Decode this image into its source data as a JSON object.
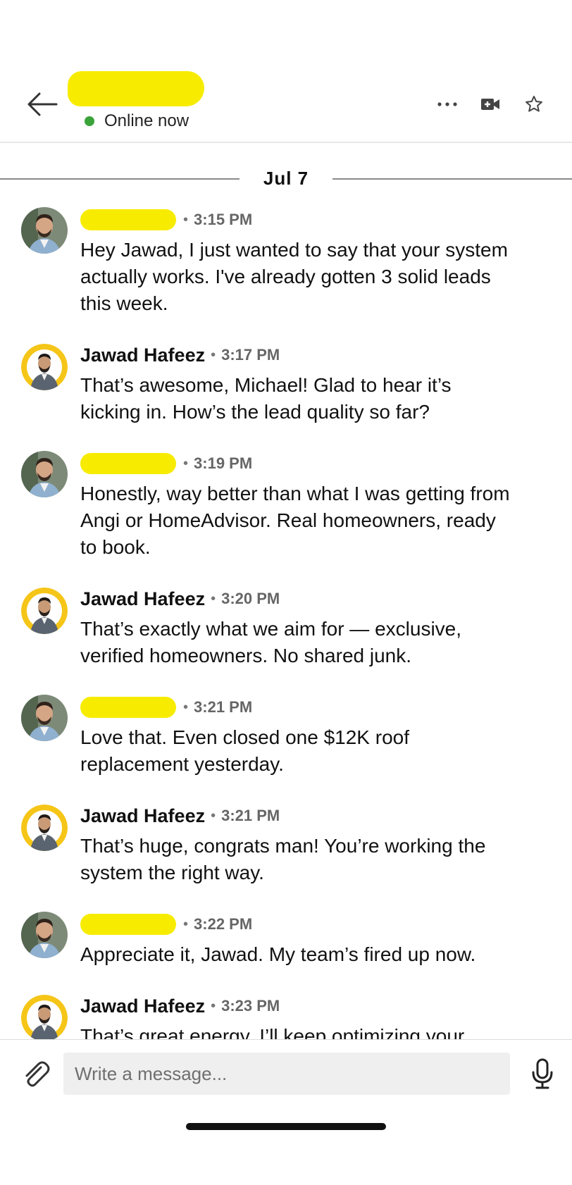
{
  "header": {
    "status": "Online now",
    "status_color": "#3aa33a"
  },
  "date_divider": "Jul 7",
  "messages": [
    {
      "sender": "",
      "time": "3:15 PM",
      "text": "Hey Jawad, I just wanted to say that your system actually works. I've already gotten 3 solid leads this week.",
      "from_self": false
    },
    {
      "sender": "Jawad Hafeez",
      "time": "3:17 PM",
      "text": "That’s awesome, Michael! Glad to hear it’s kicking in. How’s the lead quality so far?",
      "from_self": true
    },
    {
      "sender": "",
      "time": "3:19 PM",
      "text": "Honestly, way better than what I was getting from Angi or HomeAdvisor. Real homeowners, ready to book.",
      "from_self": false
    },
    {
      "sender": "Jawad Hafeez",
      "time": "3:20 PM",
      "text": "That’s exactly what we aim for — exclusive, verified homeowners. No shared junk.",
      "from_self": true
    },
    {
      "sender": "",
      "time": "3:21 PM",
      "text": "Love that. Even closed one $12K roof replacement yesterday.",
      "from_self": false
    },
    {
      "sender": "Jawad Hafeez",
      "time": "3:21 PM",
      "text": "That’s huge, congrats man! You’re working the system the right way.",
      "from_self": true
    },
    {
      "sender": "",
      "time": "3:22 PM",
      "text": "Appreciate it, Jawad. My team’s fired up now.",
      "from_self": false
    },
    {
      "sender": "Jawad Hafeez",
      "time": "3:23 PM",
      "text": "That’s great energy. I’ll keep optimizing your",
      "from_self": true
    }
  ],
  "composer": {
    "placeholder": "Write a message..."
  },
  "colors": {
    "redaction": "#f7ec00",
    "avatar_ring": "#f5c518"
  }
}
